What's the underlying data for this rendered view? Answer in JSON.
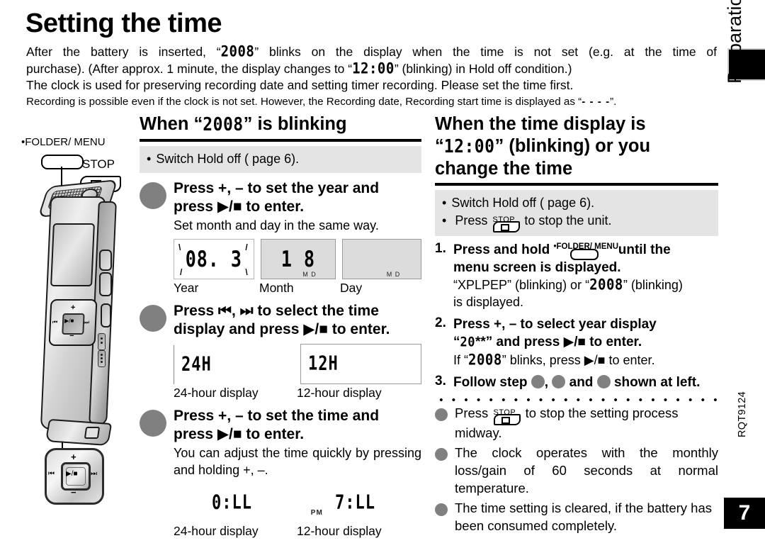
{
  "page": {
    "title": "Setting the time",
    "rail_label": "Preparation",
    "doc_code": "RQT9124",
    "page_number": "7"
  },
  "intro": {
    "line1_a": "After the battery is inserted, “",
    "line1_lcd": "2008",
    "line1_b": "” blinks on the display when the time is not set (e.g. at the time of",
    "line2_a": "purchase). (After approx. 1 minute, the display changes to “",
    "line2_lcd": "12:00",
    "line2_b": "” (blinking) in Hold off condition.)",
    "line3": "The clock is used for preserving recording date and setting timer recording. Please set the time first.",
    "line4_a": "Recording is possible even if the clock is not set. However, the Recording date, Recording start time is displayed as “",
    "line4_dashes": "- - - -",
    "line4_b": "”."
  },
  "device": {
    "folder_menu_label": "•FOLDER/  MENU",
    "stop_label": "STOP",
    "pad_plus": "+",
    "pad_minus": "−",
    "pad_prev": "⏮",
    "pad_next": "⏭",
    "pad_play": "▶/■"
  },
  "left_column": {
    "heading_a": "When “",
    "heading_lcd": "2008",
    "heading_b": "” is blinking",
    "note": "Switch Hold off (    page 6).",
    "steps": [
      {
        "bold_line1": "Press +, – to set the year and",
        "bold_line2": "press ▶/■ to enter.",
        "sub": "Set month and day in the same way.",
        "panels": [
          {
            "seg": "08. 3",
            "caption": "Year",
            "shade": "white",
            "marks": ""
          },
          {
            "seg": "1 8",
            "caption": "Month",
            "shade": "gray",
            "marks": "M        D"
          },
          {
            "seg": "",
            "caption": "Day",
            "shade": "gray",
            "marks": "M        D"
          }
        ]
      },
      {
        "bold_line1": "Press ⏮, ⏭ to select the time",
        "bold_line2": "display and press ▶/■ to enter.",
        "sub": "",
        "panels": [
          {
            "seg": "24H",
            "caption": "24-hour display",
            "shade": "none",
            "marks": ""
          },
          {
            "seg": "12H",
            "caption": "12-hour display",
            "shade": "none",
            "marks": ""
          }
        ]
      },
      {
        "bold_line1": "Press +, – to set the time and",
        "bold_line2": "press ▶/■ to enter.",
        "sub": "You can adjust the time quickly by pressing and holding +, –.",
        "panels": [
          {
            "seg": "0:LL",
            "caption": "24-hour display",
            "shade": "none",
            "marks": ""
          },
          {
            "seg": "7:LL",
            "caption": "12-hour display",
            "shade": "none",
            "marks": "PM"
          }
        ]
      }
    ]
  },
  "right_column": {
    "heading_line1": "When the time display is",
    "heading_lcd": "12:00",
    "heading_line2_a": "“",
    "heading_line2_b": "” (blinking) or you",
    "heading_line3": "change the time",
    "notes": [
      "Switch Hold off (    page 6).",
      "Press  to stop the unit."
    ],
    "note2_pre": "Press",
    "note2_post": "to stop the unit.",
    "steps": [
      {
        "n": "1.",
        "bold_pre": "Press and hold",
        "bold_post": "until the",
        "bold_line2": "menu screen is displayed.",
        "plain_a": "“XPLPEP” (blinking) or “",
        "plain_lcd": "2008",
        "plain_b": "” (blinking)",
        "plain_line2": "is displayed."
      },
      {
        "n": "2.",
        "bold_line1": "Press +, – to select year display",
        "bold_line2_a": "“",
        "bold_line2_lcd": "20",
        "bold_line2_b": "**” and press ▶/■ to enter.",
        "plain_a": "If “",
        "plain_lcd": "2008",
        "plain_b": "” blinks, press ▶/■ to enter."
      },
      {
        "n": "3.",
        "bold_a": "Follow step",
        "bold_b": ",",
        "bold_c": "and",
        "bold_d": "shown at left."
      }
    ],
    "bullets": [
      {
        "pre": "Press",
        "post": "to stop the setting process midway."
      },
      {
        "text": "The clock operates with the monthly loss/gain of 60 seconds at normal temperature."
      },
      {
        "text": "The time setting is cleared, if the battery has been consumed completely."
      }
    ]
  },
  "colors": {
    "gray_circle": "#808080",
    "note_background": "#e4e4e4",
    "lcd_panel_gray": "#dcdcdc",
    "black": "#000000"
  }
}
